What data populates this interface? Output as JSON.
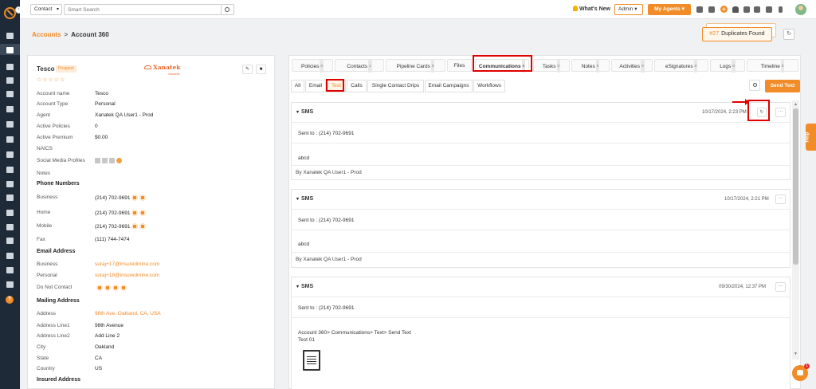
{
  "topbar": {
    "context_select": "Contact",
    "search_placeholder": "Smart Search",
    "whats_new": "What's New",
    "admin_select": "Admin",
    "my_agents": "My Agents"
  },
  "breadcrumb": {
    "parent": "Accounts",
    "separator": ">",
    "current": "Account 360"
  },
  "duplicates": {
    "count": "#27",
    "label": "Duplicates Found"
  },
  "account": {
    "name": "Tesco",
    "status": "Prospect",
    "brand_name": "Xanatek",
    "brand_sub": "Xanatek",
    "stars": "☆☆☆☆☆",
    "details": [
      {
        "label": "Account name",
        "value": "Tesco"
      },
      {
        "label": "Account Type",
        "value": "Personal"
      },
      {
        "label": "Agent",
        "value": "Xanatek QA User1 - Prod"
      },
      {
        "label": "Active Policies",
        "value": "0"
      },
      {
        "label": "Active Premium",
        "value": "$0.00"
      },
      {
        "label": "NAICS",
        "value": ""
      },
      {
        "label": "Social Media Profiles",
        "value": ""
      },
      {
        "label": "Notes",
        "value": ""
      }
    ],
    "phone_heading": "Phone Numbers",
    "phones": [
      {
        "label": "Business",
        "value": "(214) 702-9691"
      },
      {
        "label": "Home",
        "value": "(214) 702-9691"
      },
      {
        "label": "Mobile",
        "value": "(214) 702-9691"
      },
      {
        "label": "Fax",
        "value": "(111) 744-7474"
      }
    ],
    "email_heading": "Email Address",
    "emails": [
      {
        "label": "Business",
        "value": "suraj+17@insuredmine.com"
      },
      {
        "label": "Personal",
        "value": "suraj+18@insuredmine.com"
      }
    ],
    "do_not_contact_label": "Do Not Contact",
    "mailing_heading": "Mailing Address",
    "mailing": [
      {
        "label": "Address",
        "value": "98th Ave, Oakland, CA, USA"
      },
      {
        "label": "Address Line1",
        "value": "98th Avenue"
      },
      {
        "label": "Address Line2",
        "value": "Add Line 2"
      },
      {
        "label": "City",
        "value": "Oakland"
      },
      {
        "label": "State",
        "value": "CA"
      },
      {
        "label": "Country",
        "value": "US"
      }
    ],
    "insured_heading": "Insured Address"
  },
  "tabs": [
    {
      "label": "Policies",
      "count": "0"
    },
    {
      "label": "Contacts",
      "count": "1"
    },
    {
      "label": "Pipeline Cards",
      "count": "0"
    },
    {
      "label": "Files",
      "count": ""
    },
    {
      "label": "Communications",
      "count": "6"
    },
    {
      "label": "Tasks",
      "count": "0"
    },
    {
      "label": "Notes",
      "count": "0"
    },
    {
      "label": "Activities",
      "count": "0"
    },
    {
      "label": "eSignatures",
      "count": "0"
    },
    {
      "label": "Logs",
      "count": "0"
    },
    {
      "label": "Timeline",
      "count": "0"
    }
  ],
  "subtabs": [
    "All",
    "Email",
    "Text",
    "Calls",
    "Single Contact Drips",
    "Email Campaigns",
    "Workflows"
  ],
  "send_text": "Send Text",
  "messages": [
    {
      "type": "SMS",
      "timestamp": "10/17/2024, 2:23 PM",
      "sent_to": "Sent to : (214) 702-9691",
      "body": "abcd",
      "by": "By Xanatek QA User1 - Prod"
    },
    {
      "type": "SMS",
      "timestamp": "10/17/2024, 2:21 PM",
      "sent_to": "Sent to : (214) 702-9691",
      "body": "abcd",
      "by": "By Xanatek QA User1 - Prod"
    },
    {
      "type": "SMS",
      "timestamp": "09/30/2024, 12:37 PM",
      "sent_to": "Sent to : (214) 702-9691",
      "body_line1": "Account 360> Communications> Text> Send Text",
      "body_line2": "Test 01"
    }
  ],
  "help_label": "Help",
  "chat_badge": "1",
  "colors": {
    "accent": "#f28c28",
    "highlight": "#e00000",
    "nav": "#1f2a38"
  }
}
